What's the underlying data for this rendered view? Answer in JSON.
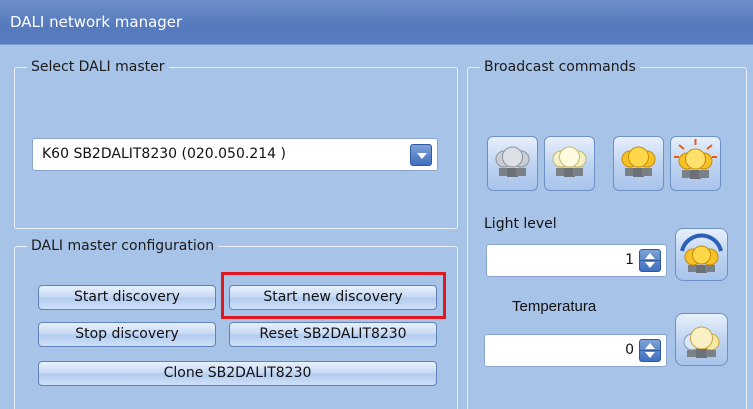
{
  "window": {
    "title": "DALI network manager"
  },
  "select_master": {
    "legend": "Select DALI master",
    "selected_value": "K60 SB2DALIT8230 (020.050.214 )"
  },
  "master_config": {
    "legend": "DALI master configuration",
    "buttons": {
      "start_discovery": "Start discovery",
      "start_new_discovery": "Start new discovery",
      "stop_discovery": "Stop discovery",
      "reset": "Reset SB2DALIT8230",
      "clone": "Clone SB2DALIT8230"
    }
  },
  "broadcast": {
    "legend": "Broadcast commands",
    "bulb_buttons": [
      {
        "icon": "bulb-off-icon"
      },
      {
        "icon": "bulb-on-icon"
      },
      {
        "icon": "bulbs-max-icon"
      },
      {
        "icon": "bulbs-bright-icon"
      }
    ],
    "light_level": {
      "label": "Light level",
      "value": "1",
      "icon": "light-level-apply-icon"
    },
    "temperatura": {
      "label": "Temperatura",
      "value": "0",
      "icon": "temperature-apply-icon"
    }
  },
  "colors": {
    "highlight_border": "#e0171f",
    "window_bg": "#a8c3e8",
    "titlebar": "#5479bd"
  }
}
